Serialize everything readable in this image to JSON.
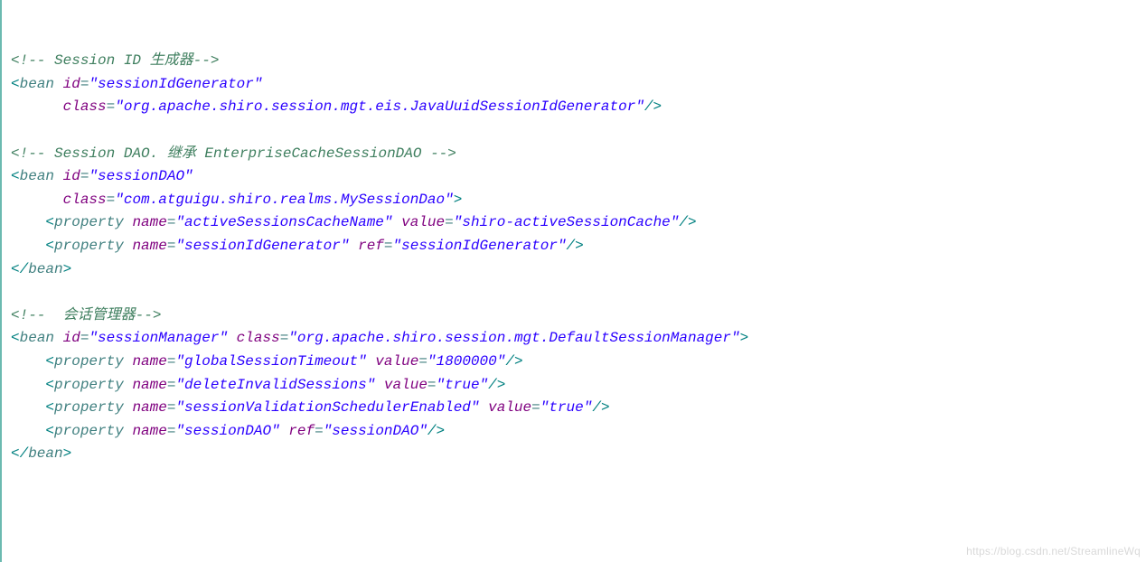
{
  "line1": {
    "open": "<!--",
    "txt": " Session ID 生成器",
    "close": "-->"
  },
  "line2": {
    "b": "<",
    "tag": "bean",
    "sp": " ",
    "a1": "id",
    "eq": "=",
    "v1": "\"sessionIdGenerator\""
  },
  "line3": {
    "ind": "      ",
    "a1": "class",
    "eq": "=",
    "v1": "\"org.apache.shiro.session.mgt.eis.JavaUuidSessionIdGenerator\"",
    "end": "/>"
  },
  "line5": {
    "open": "<!--",
    "txt": " Session DAO. 继承 EnterpriseCacheSessionDAO ",
    "close": "-->"
  },
  "line6": {
    "b": "<",
    "tag": "bean",
    "sp": " ",
    "a1": "id",
    "eq": "=",
    "v1": "\"sessionDAO\""
  },
  "line7": {
    "ind": "      ",
    "a1": "class",
    "eq": "=",
    "v1": "\"com.atguigu.shiro.realms.MySessionDao\"",
    "end": ">"
  },
  "line8": {
    "ind": "    ",
    "b": "<",
    "tag": "property",
    "sp": " ",
    "a1": "name",
    "eq": "=",
    "v1": "\"activeSessionsCacheName\"",
    "sp2": " ",
    "a2": "value",
    "v2": "\"shiro-activeSessionCache\"",
    "end": "/>"
  },
  "line9": {
    "ind": "    ",
    "b": "<",
    "tag": "property",
    "sp": " ",
    "a1": "name",
    "eq": "=",
    "v1": "\"sessionIdGenerator\"",
    "sp2": " ",
    "a2": "ref",
    "v2": "\"sessionIdGenerator\"",
    "end": "/>"
  },
  "line10": {
    "b": "</",
    "tag": "bean",
    "end": ">"
  },
  "line12": {
    "open": "<!--",
    "txt": "  会话管理器",
    "close": "-->"
  },
  "line13": {
    "b": "<",
    "tag": "bean",
    "sp": " ",
    "a1": "id",
    "eq": "=",
    "v1": "\"sessionManager\"",
    "sp2": " ",
    "a2": "class",
    "v2": "\"org.apache.shiro.session.mgt.DefaultSessionManager\"",
    "end": ">"
  },
  "line14": {
    "ind": "    ",
    "b": "<",
    "tag": "property",
    "sp": " ",
    "a1": "name",
    "eq": "=",
    "v1": "\"globalSessionTimeout\"",
    "sp2": " ",
    "a2": "value",
    "v2": "\"1800000\"",
    "end": "/>"
  },
  "line15": {
    "ind": "    ",
    "b": "<",
    "tag": "property",
    "sp": " ",
    "a1": "name",
    "eq": "=",
    "v1": "\"deleteInvalidSessions\"",
    "sp2": " ",
    "a2": "value",
    "v2": "\"true\"",
    "end": "/>"
  },
  "line16": {
    "ind": "    ",
    "b": "<",
    "tag": "property",
    "sp": " ",
    "a1": "name",
    "eq": "=",
    "v1": "\"sessionValidationSchedulerEnabled\"",
    "sp2": " ",
    "a2": "value",
    "v2": "\"true\"",
    "end": "/>"
  },
  "line17": {
    "ind": "    ",
    "b": "<",
    "tag": "property",
    "sp": " ",
    "a1": "name",
    "eq": "=",
    "v1": "\"sessionDAO\"",
    "sp2": " ",
    "a2": "ref",
    "v2": "\"sessionDAO\"",
    "end": "/>"
  },
  "line18": {
    "b": "</",
    "tag": "bean",
    "end": ">"
  },
  "watermark": "https://blog.csdn.net/StreamlineWq"
}
